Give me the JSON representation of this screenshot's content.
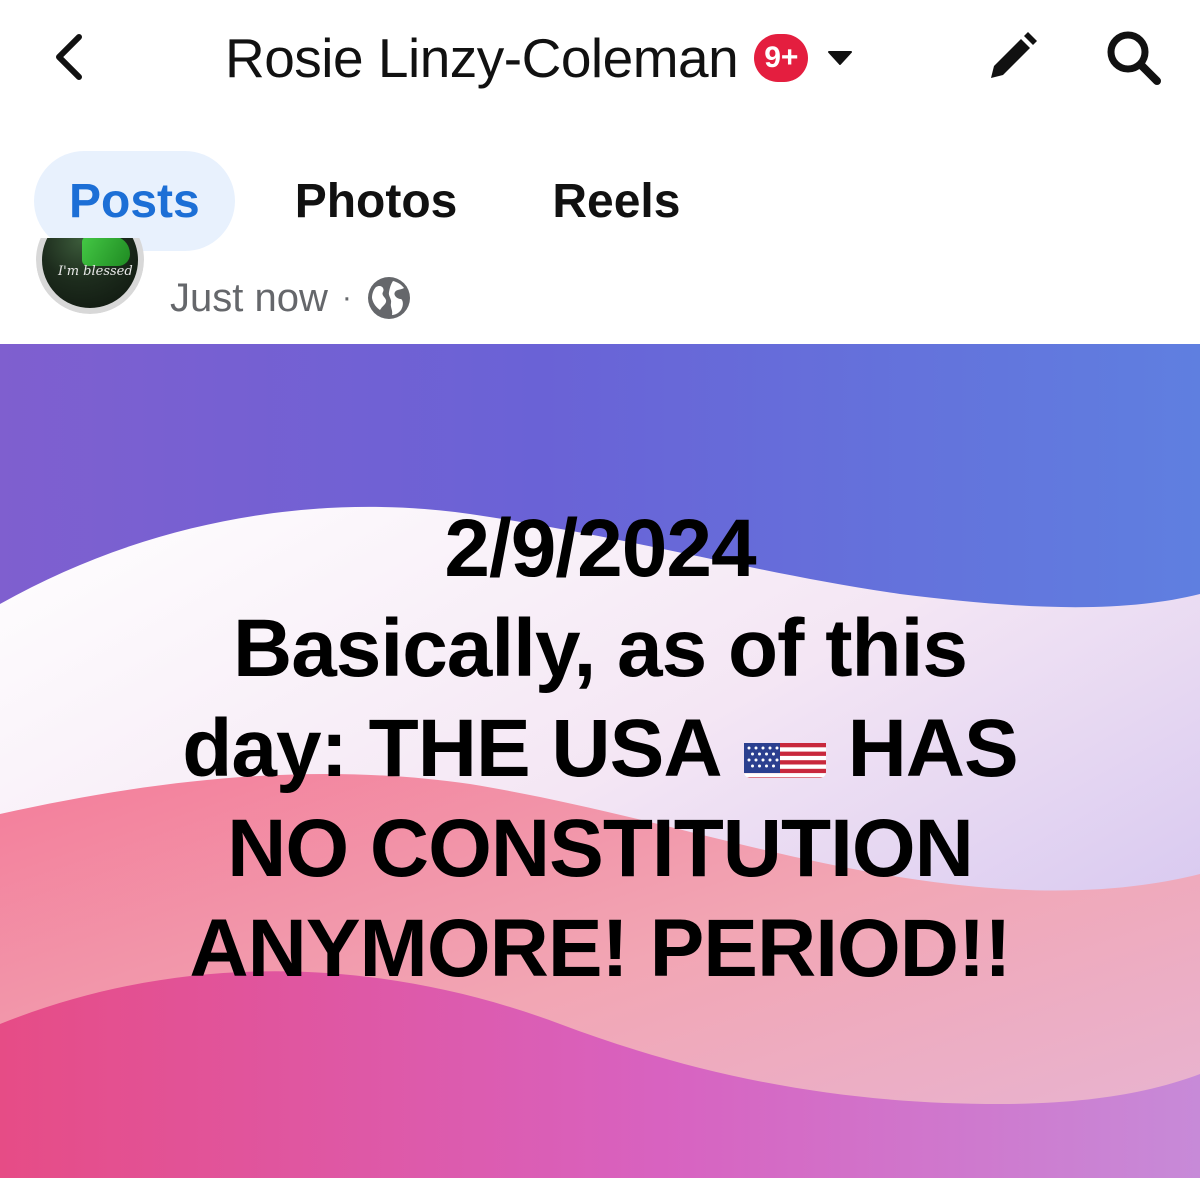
{
  "header": {
    "back_icon": "chevron-left-icon",
    "title": "Rosie Linzy-Coleman",
    "notification_count": "9+",
    "notification_color": "#e41e3f",
    "dropdown_icon": "caret-down-icon",
    "edit_icon": "pencil-icon",
    "search_icon": "search-icon"
  },
  "tabs": [
    {
      "label": "Posts",
      "active": true
    },
    {
      "label": "Photos",
      "active": false
    },
    {
      "label": "Reels",
      "active": false
    }
  ],
  "post": {
    "avatar_caption": "I'm blessed",
    "timestamp": "Just now",
    "separator": "·",
    "audience_icon": "globe-icon",
    "text_lines": [
      "2/9/2024",
      "Basically, as of this",
      "day:  THE USA",
      "HAS",
      "NO CONSTITUTION",
      "ANYMORE!  PERIOD!!"
    ],
    "emoji": "us-flag-emoji"
  },
  "colors": {
    "accent": "#1c6fd6",
    "active_tab_bg": "#e8f1fd",
    "meta_text": "#65676b"
  }
}
